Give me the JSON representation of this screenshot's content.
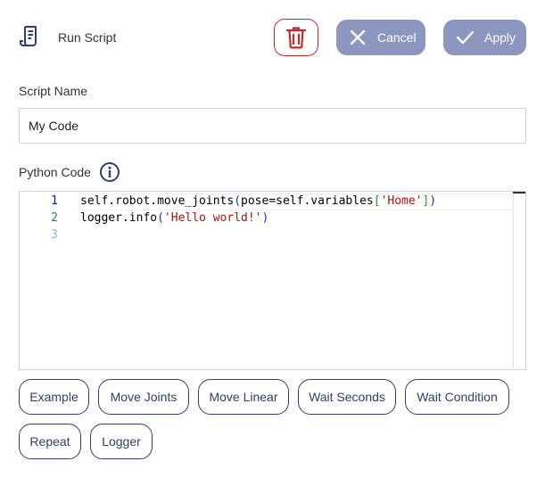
{
  "header": {
    "title": "Run Script",
    "icon": "script-icon",
    "delete_icon": "trash-icon",
    "cancel_label": "Cancel",
    "apply_label": "Apply"
  },
  "script_name": {
    "label": "Script Name",
    "value": "My Code"
  },
  "python_code": {
    "label": "Python Code",
    "info_icon": "info-icon",
    "line_numbers": [
      "1",
      "2",
      "3"
    ],
    "lines": [
      "self.robot.move_joints(pose=self.variables['Home'])",
      "logger.info('Hello world!')",
      ""
    ]
  },
  "snippets": [
    "Example",
    "Move Joints",
    "Move Linear",
    "Wait Seconds",
    "Wait Condition",
    "Repeat",
    "Logger"
  ],
  "colors": {
    "accent": "#8c97c0",
    "danger": "#c62828",
    "outline": "#2f3f6e"
  }
}
